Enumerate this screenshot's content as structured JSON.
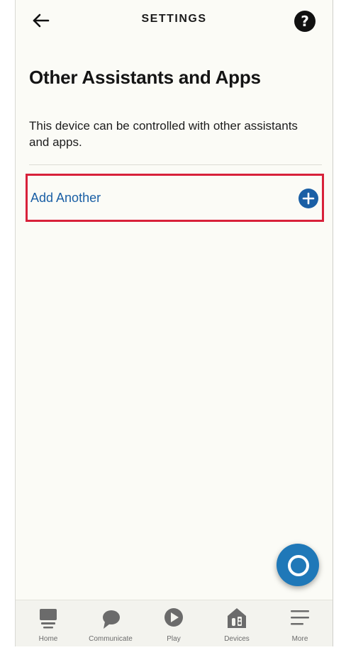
{
  "header": {
    "back_icon": "arrow-left-icon",
    "title": "SETTINGS",
    "help_glyph": "?",
    "help_icon": "help-circle-icon"
  },
  "page": {
    "title": "Other Assistants and Apps",
    "description": "This device can be controlled with other assistants and apps."
  },
  "add_row": {
    "label": "Add Another",
    "icon": "plus-circle-icon",
    "highlight_color": "#d8213a"
  },
  "fab": {
    "icon": "alexa-ring-icon"
  },
  "bottom_nav": {
    "items": [
      {
        "label": "Home",
        "icon": "home-icon"
      },
      {
        "label": "Communicate",
        "icon": "chat-bubble-icon"
      },
      {
        "label": "Play",
        "icon": "play-icon"
      },
      {
        "label": "Devices",
        "icon": "devices-icon"
      },
      {
        "label": "More",
        "icon": "menu-icon"
      }
    ]
  },
  "colors": {
    "accent": "#1a5fa5",
    "fab": "#1f78b8",
    "background": "#fbfbf6",
    "nav_icon": "#6b6b6b"
  }
}
